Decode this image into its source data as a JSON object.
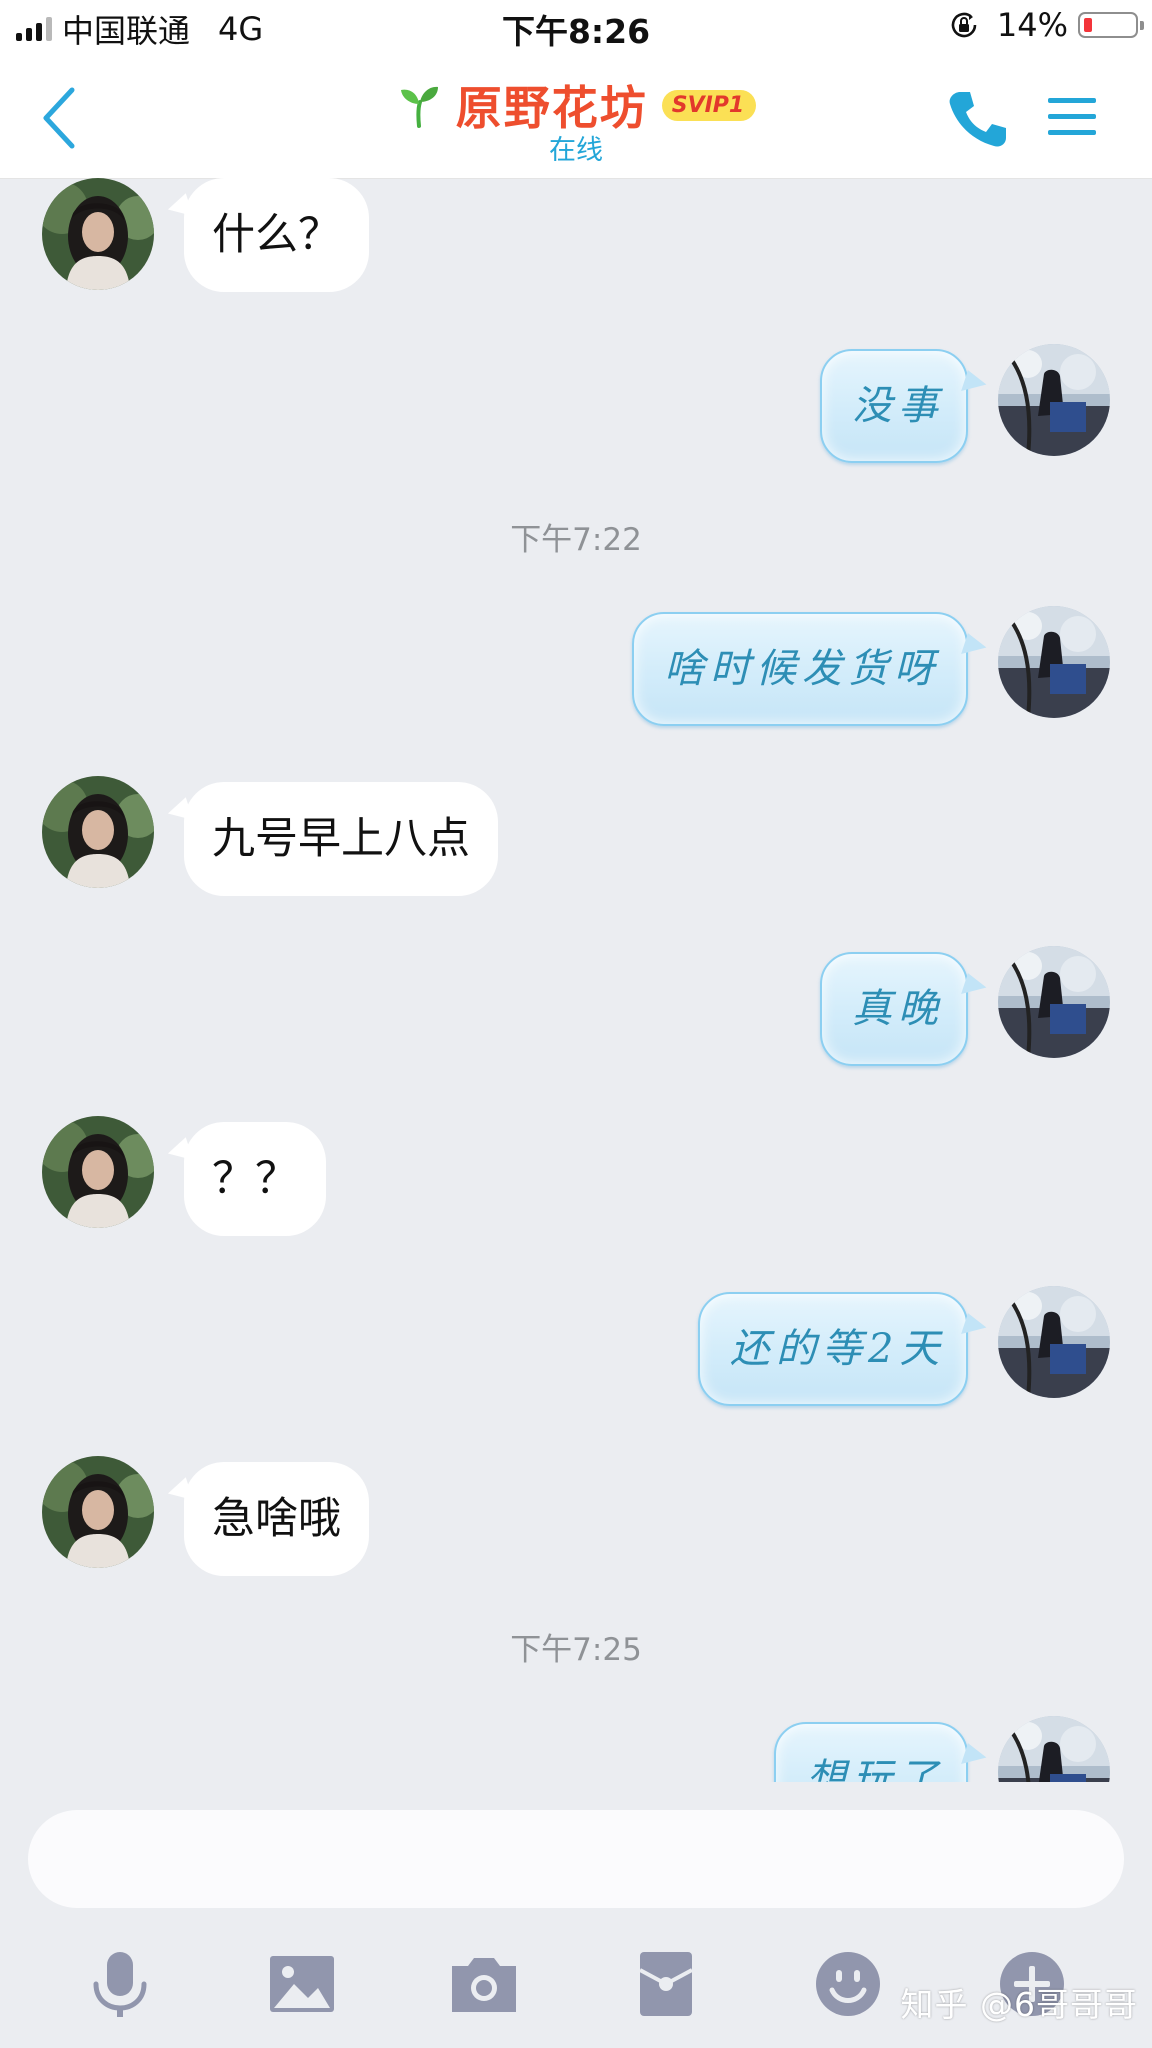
{
  "status_bar": {
    "carrier": "中国联通",
    "network": "4G",
    "time": "下午8:26",
    "battery": "14%",
    "battery_level": 0.14
  },
  "header": {
    "title": "原野花坊",
    "badge": "SVIP1",
    "subtitle": "在线",
    "icons": [
      "back-icon",
      "sprout-icon",
      "phone-icon",
      "menu-icon"
    ]
  },
  "messages": [
    {
      "dir": "in",
      "text": "什么？"
    },
    {
      "dir": "out",
      "text": "没事"
    },
    {
      "dir": "time",
      "text": "下午7:22"
    },
    {
      "dir": "out",
      "text": "啥时候发货呀"
    },
    {
      "dir": "in",
      "text": "九号早上八点"
    },
    {
      "dir": "out",
      "text": "真晚"
    },
    {
      "dir": "in",
      "text": "？？"
    },
    {
      "dir": "out",
      "text": "还的等2天"
    },
    {
      "dir": "in",
      "text": "急啥哦"
    },
    {
      "dir": "time",
      "text": "下午7:25"
    },
    {
      "dir": "out",
      "text": "想玩了"
    }
  ],
  "input": {
    "value": "",
    "tools": [
      "microphone-icon",
      "image-icon",
      "camera-icon",
      "red-packet-icon",
      "emoji-icon",
      "plus-icon"
    ]
  },
  "watermark": "知乎 @6哥哥哥",
  "colors": {
    "title": "#ee4e2e",
    "accent": "#23a6d8",
    "background": "#ebedf1",
    "outgoing_bubble_border": "#8ccff1",
    "outgoing_text": "#2d8eb5",
    "toolbar_icon": "#9196ad"
  }
}
